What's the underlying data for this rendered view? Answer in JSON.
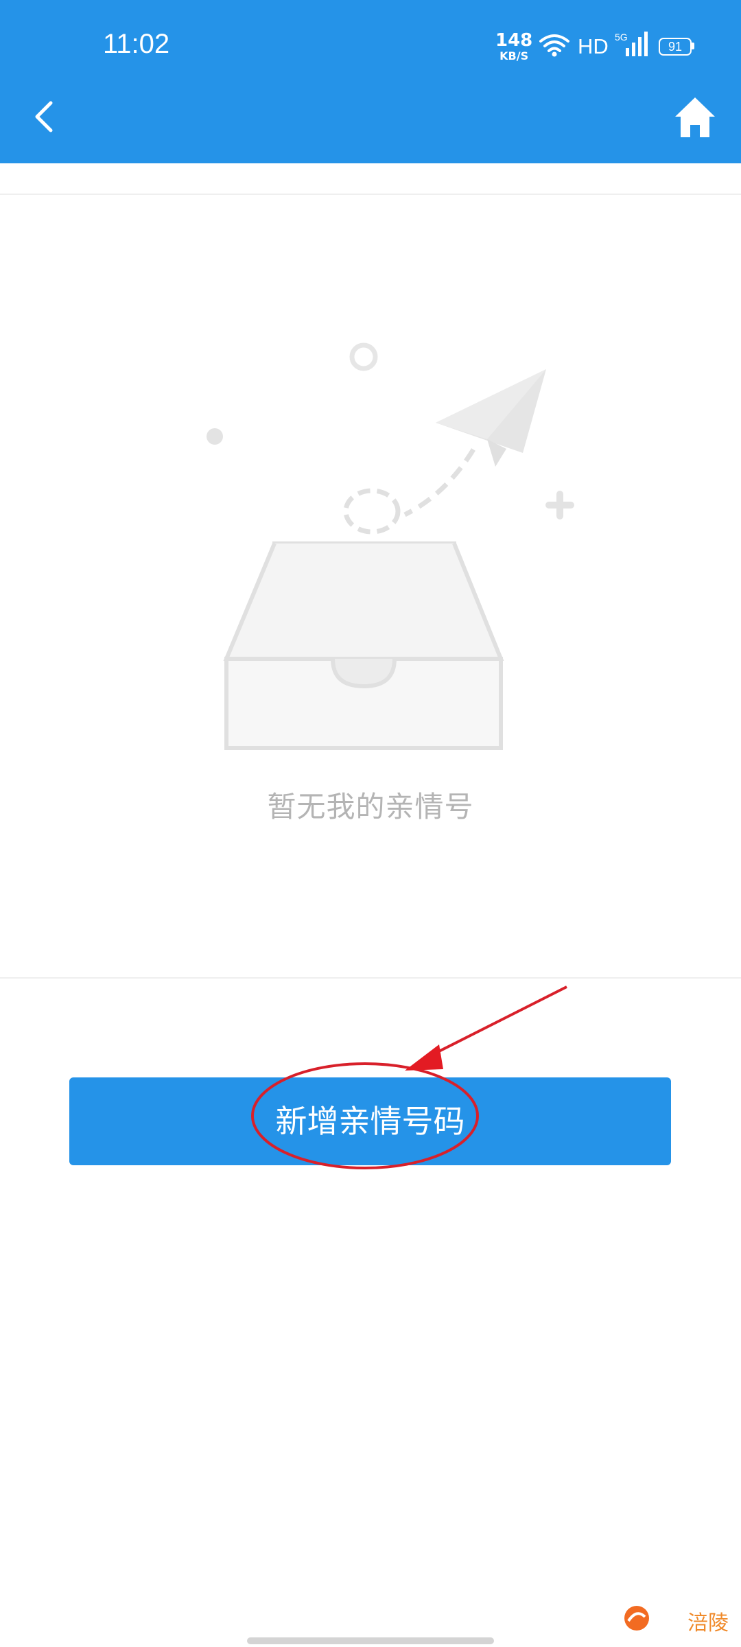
{
  "status_bar": {
    "time": "11:02",
    "net_speed_value": "148",
    "net_speed_unit": "KB/S",
    "network_label": "HD",
    "signal_label": "5G",
    "battery_level": "91"
  },
  "header": {
    "background_color": "#2593e8",
    "back_icon": "chevron-left-icon",
    "home_icon": "home-icon"
  },
  "empty_state": {
    "illustration": "paper-plane-and-empty-box",
    "message": "暂无我的亲情号"
  },
  "actions": {
    "add_button_label": "新增亲情号码",
    "add_button_color": "#2593e8"
  },
  "watermark": {
    "text": "涪陵"
  }
}
